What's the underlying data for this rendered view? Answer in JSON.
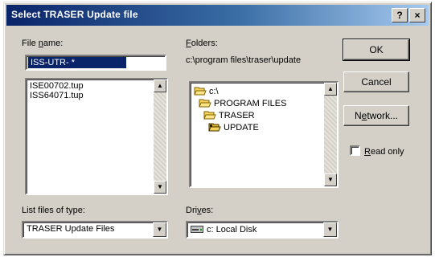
{
  "window": {
    "title": "Select TRASER Update file",
    "help_button": "?",
    "close_button": "×"
  },
  "file_name": {
    "label_prefix": "File ",
    "label_underlined": "n",
    "label_suffix": "ame:",
    "value": "ISS-UTR-  *"
  },
  "file_list": {
    "items": [
      "ISE00702.tup",
      "ISS64071.tup"
    ]
  },
  "folders": {
    "label_prefix": "",
    "label_underlined": "F",
    "label_suffix": "olders:",
    "path": "c:\\program files\\traser\\update",
    "tree": [
      {
        "name": "c:\\",
        "icon": "open-folder-icon"
      },
      {
        "name": "PROGRAM FILES",
        "icon": "open-folder-icon"
      },
      {
        "name": "TRASER",
        "icon": "open-folder-icon"
      },
      {
        "name": "UPDATE",
        "icon": "open-folder-selected-icon"
      }
    ]
  },
  "buttons": {
    "ok": "OK",
    "cancel": "Cancel",
    "network_prefix": "N",
    "network_underlined": "e",
    "network_suffix": "twork..."
  },
  "read_only": {
    "label_prefix": "",
    "label_underlined": "R",
    "label_suffix": "ead only",
    "checked": false
  },
  "file_types": {
    "label": "List files of type:",
    "value": "TRASER Update Files"
  },
  "drives": {
    "label_prefix": "Dri",
    "label_underlined": "v",
    "label_suffix": "es:",
    "value": "c: Local Disk",
    "icon": "hard-drive-icon"
  }
}
